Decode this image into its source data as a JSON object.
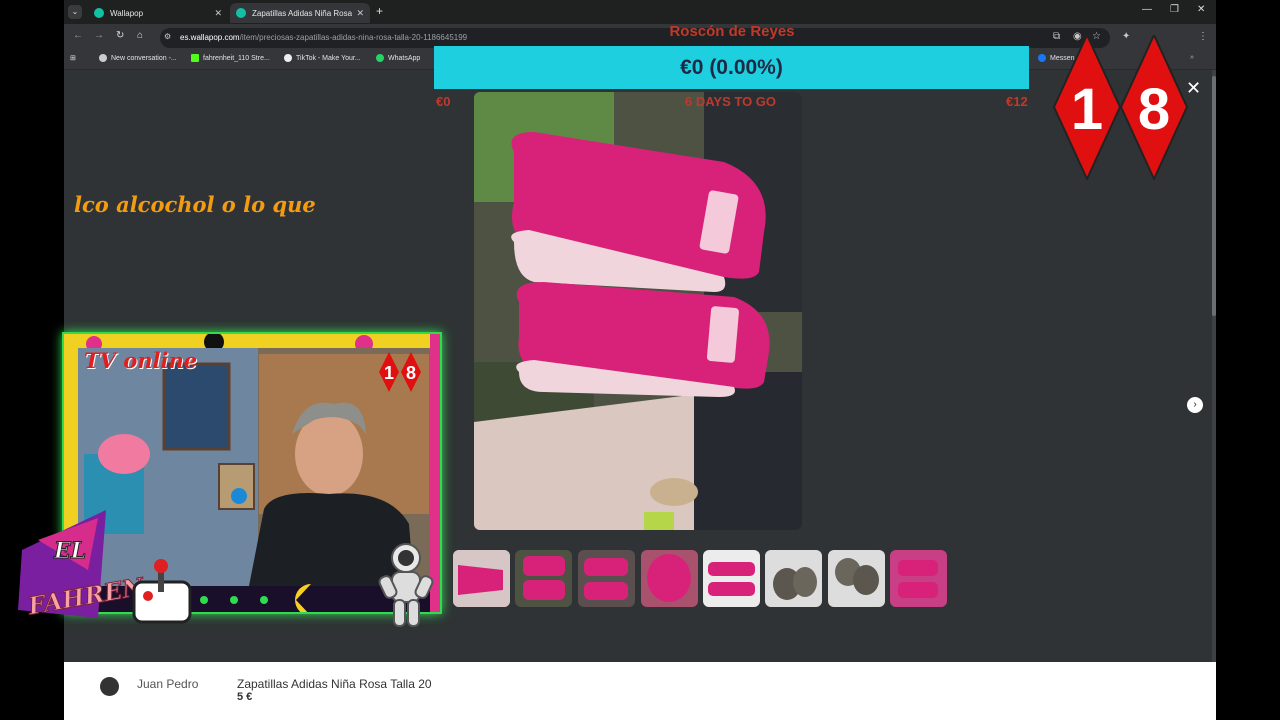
{
  "browser": {
    "tabs": [
      {
        "title": "Wallapop",
        "active": false
      },
      {
        "title": "Zapatillas Adidas Niña Rosa Ta...",
        "active": true
      }
    ],
    "url_domain": "es.wallapop.com",
    "url_path": "/item/preciosas-zapatillas-adidas-nina-rosa-talla-20-1186645199",
    "bookmarks": [
      "New conversation -...",
      "fahrenheit_110 Stre...",
      "TikTok - Make Your...",
      "WhatsApp",
      "Messen..."
    ]
  },
  "overlay": {
    "goal_title": "Roscón de Reyes",
    "goal_value": "€0 (0.00%)",
    "goal_progress": 0.0,
    "goal_min": "€0",
    "goal_countdown": "6 DAYS TO GO",
    "goal_max": "€12",
    "ticker_text": "lco alcochol o lo que",
    "age_badge": [
      "1",
      "8"
    ],
    "cam_title": "TV online",
    "cam_badge": [
      "1",
      "8"
    ],
    "logo_text": "EL FAHREN"
  },
  "listing": {
    "seller": "Juan Pedro",
    "title": "Zapatillas Adidas Niña Rosa Talla 20",
    "price": "5 €",
    "thumbnail_count": 8
  },
  "colors": {
    "goal_bar": "#1ecfe0",
    "goal_text": "#c0392b",
    "ticker": "#f39c12",
    "cam_border": "#2fdc4e",
    "shoe_pink": "#d8227a"
  }
}
